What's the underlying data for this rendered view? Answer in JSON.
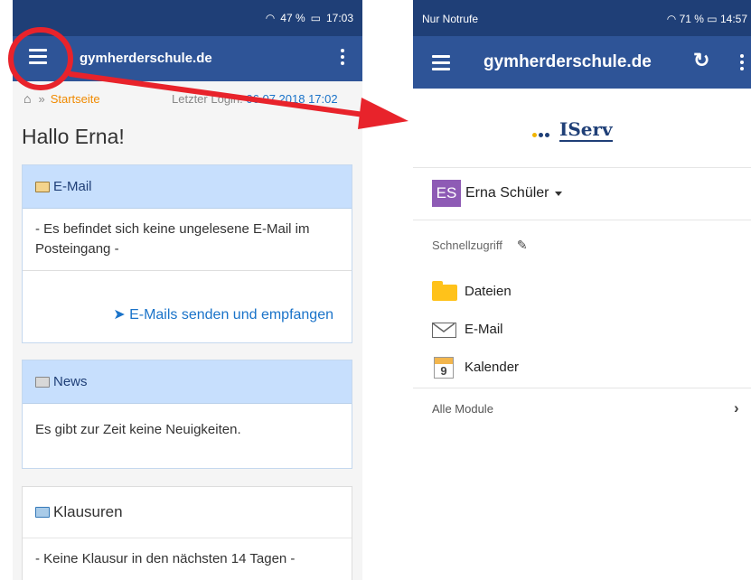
{
  "left_screen": {
    "status": {
      "signal": "47 %",
      "time": "17:03"
    },
    "appbar": {
      "title": "gymherderschule.de"
    },
    "breadcrumb": {
      "sep": "»",
      "current": "Startseite",
      "last_login_label": "Letzter Login:",
      "last_login_date": "06.07.2018 17:02"
    },
    "greeting": "Hallo Erna!",
    "email_panel": {
      "title": "E-Mail",
      "body": "- Es befindet sich keine ungelesene E-Mail im Posteingang -",
      "action": "E-Mails senden und empfangen"
    },
    "news_panel": {
      "title": "News",
      "body": "Es gibt zur Zeit keine Neuigkeiten."
    },
    "exam_panel": {
      "title": "Klausuren",
      "body": "- Keine Klausur in den nächsten 14 Tagen -"
    }
  },
  "right_screen": {
    "status": {
      "carrier": "Nur Notrufe",
      "signal": "71 %",
      "time": "14:57"
    },
    "appbar": {
      "title": "gymherderschule.de"
    },
    "logo_text": "IServ",
    "user": {
      "initials": "ES",
      "name": "Erna Schüler"
    },
    "quick_access_label": "Schnellzugriff",
    "quick_items": [
      {
        "label": "Dateien",
        "icon": "folder-icon"
      },
      {
        "label": "E-Mail",
        "icon": "envelope-icon"
      },
      {
        "label": "Kalender",
        "icon": "calendar-icon",
        "calendar_day": "9"
      }
    ],
    "all_modules_label": "Alle Module"
  },
  "colors": {
    "appbar": "#2e5497",
    "statusbar": "#1f3f77",
    "panel_header": "#c7dffd",
    "link": "#1a73c9",
    "breadcrumb_active": "#f08a00",
    "annotation": "#e8232b",
    "avatar": "#8e5bb5",
    "folder": "#ffc21a"
  }
}
